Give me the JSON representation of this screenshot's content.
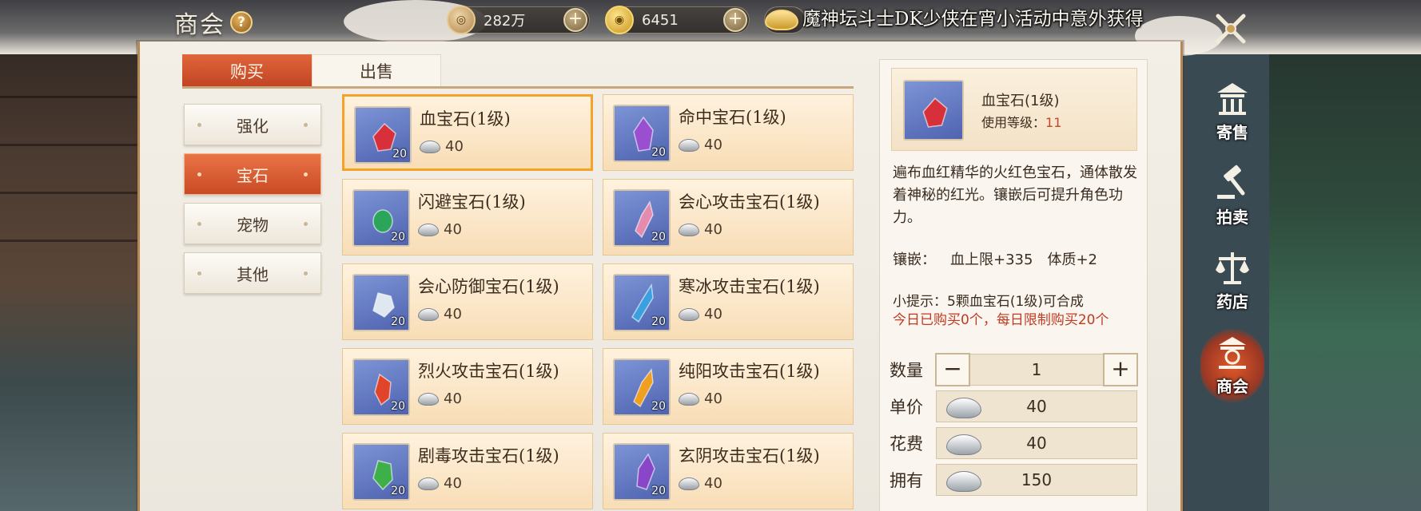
{
  "header": {
    "title": "商会",
    "help_glyph": "?",
    "copper_amount": "282万",
    "gold_amount": "6451",
    "ticker": "魔神坛斗士DK少侠在宵小活动中意外获得"
  },
  "tabs": [
    {
      "label": "购买",
      "active": true
    },
    {
      "label": "出售",
      "active": false
    }
  ],
  "categories": [
    {
      "label": "强化",
      "active": false
    },
    {
      "label": "宝石",
      "active": true
    },
    {
      "label": "宠物",
      "active": false
    },
    {
      "label": "其他",
      "active": false
    }
  ],
  "items": [
    {
      "name": "血宝石(1级)",
      "count": "20",
      "price": "40",
      "gem": "#d8303a"
    },
    {
      "name": "命中宝石(1级)",
      "count": "20",
      "price": "40",
      "gem": "#9a4fd0"
    },
    {
      "name": "闪避宝石(1级)",
      "count": "20",
      "price": "40",
      "gem": "#2aa55a"
    },
    {
      "name": "会心攻击宝石(1级)",
      "count": "20",
      "price": "40",
      "gem": "#e58bb0"
    },
    {
      "name": "会心防御宝石(1级)",
      "count": "20",
      "price": "40",
      "gem": "#dfe7f0"
    },
    {
      "name": "寒冰攻击宝石(1级)",
      "count": "20",
      "price": "40",
      "gem": "#3aa0e0"
    },
    {
      "name": "烈火攻击宝石(1级)",
      "count": "20",
      "price": "40",
      "gem": "#e0452a"
    },
    {
      "name": "纯阳攻击宝石(1级)",
      "count": "20",
      "price": "40",
      "gem": "#f0a020"
    },
    {
      "name": "剧毒攻击宝石(1级)",
      "count": "20",
      "price": "40",
      "gem": "#3db04a"
    },
    {
      "name": "玄阴攻击宝石(1级)",
      "count": "20",
      "price": "40",
      "gem": "#8a46c8"
    }
  ],
  "detail": {
    "name": "血宝石(1级)",
    "level_label": "使用等级：",
    "level_value": "11",
    "description": "遍布血红精华的火红色宝石，通体散发着神秘的红光。镶嵌后可提升角色功力。",
    "inlay_label": "镶嵌：",
    "inlay_stat1": "血上限+335",
    "inlay_stat2": "体质+2",
    "tip": "小提示：5颗血宝石(1级)可合成",
    "limit": "今日已购买0个，每日限制购买20个",
    "quantity_label": "数量",
    "quantity": "1",
    "unit_price_label": "单价",
    "unit_price": "40",
    "cost_label": "花费",
    "cost": "40",
    "owned_label": "拥有",
    "owned": "150"
  },
  "right_nav": [
    {
      "label": "寄售",
      "icon": "pavilion-icon",
      "active": false
    },
    {
      "label": "拍卖",
      "icon": "gavel-icon",
      "active": false
    },
    {
      "label": "药店",
      "icon": "scale-icon",
      "active": false
    },
    {
      "label": "商会",
      "icon": "guild-icon",
      "active": true
    }
  ],
  "colors": {
    "accent": "#c94a25",
    "selected_border": "#f4a22a",
    "limit_text": "#c03a22"
  }
}
